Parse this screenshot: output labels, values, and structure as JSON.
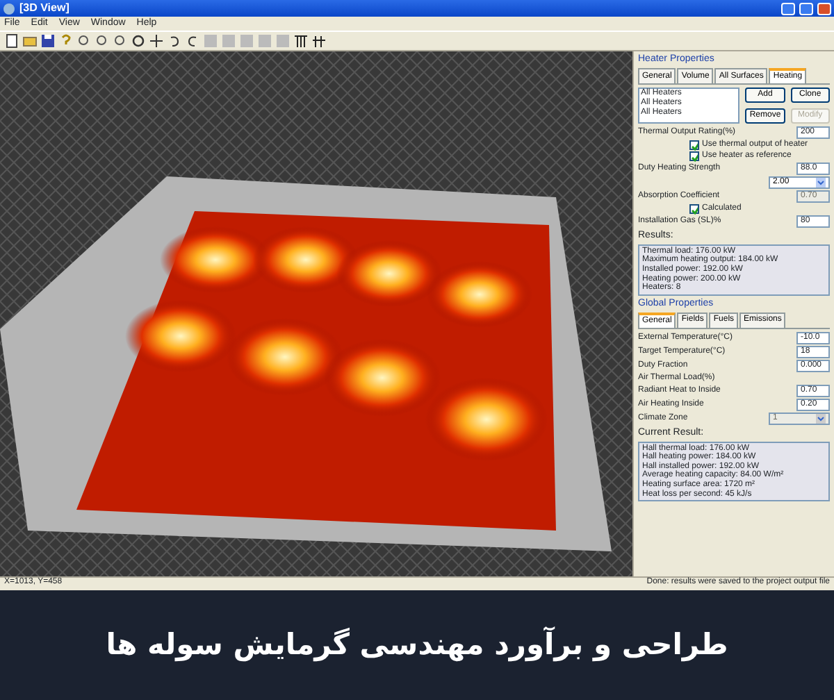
{
  "window": {
    "title": "[3D View]",
    "menus": [
      "File",
      "Edit",
      "View",
      "Window",
      "Help"
    ]
  },
  "heater_properties": {
    "title": "Heater Properties",
    "tabs": [
      {
        "label": "General",
        "selected": false
      },
      {
        "label": "Volume",
        "selected": false
      },
      {
        "label": "All Surfaces",
        "selected": false
      },
      {
        "label": "Heating",
        "selected": true
      }
    ],
    "heaters": [
      {
        "label": "All Heaters",
        "selected": false
      },
      {
        "label": "All Heaters",
        "selected": false
      },
      {
        "label": "All Heaters",
        "selected": false
      }
    ],
    "buttons": [
      {
        "label": "Add",
        "disabled": false
      },
      {
        "label": "Clone",
        "disabled": false
      },
      {
        "label": "Remove",
        "disabled": false
      },
      {
        "label": "Modify",
        "disabled": true
      }
    ],
    "fields": [
      {
        "kind": "input",
        "label": "Thermal Output Rating(%)",
        "value": "200",
        "disabled": false
      },
      {
        "kind": "check",
        "label": "Use thermal output of heater",
        "checked": true
      },
      {
        "kind": "check",
        "label": "Use heater as reference",
        "checked": true
      },
      {
        "kind": "input",
        "label": "Duty Heating Strength",
        "value": "88.0",
        "disabled": false
      },
      {
        "kind": "select",
        "value": "2.00",
        "disabled": false
      },
      {
        "kind": "input",
        "label": "Absorption Coefficient",
        "value": "0.70",
        "disabled": true
      },
      {
        "kind": "check",
        "label": "Calculated",
        "checked": true
      },
      {
        "kind": "input",
        "label": "Installation Gas (SL)%",
        "value": "80",
        "disabled": false
      }
    ]
  },
  "results": {
    "title": "Results:",
    "lines": [
      "Thermal load: 176.00 kW",
      "Maximum heating output: 184.00 kW",
      "Installed power: 192.00 kW",
      "Heating power: 200.00 kW",
      "Heaters: 8"
    ]
  },
  "global_properties": {
    "title": "Global Properties",
    "tabs": [
      {
        "label": "General",
        "selected": true
      },
      {
        "label": "Fields",
        "selected": false
      },
      {
        "label": "Fuels",
        "selected": false
      },
      {
        "label": "Emissions",
        "selected": false
      }
    ],
    "fields": [
      {
        "kind": "input",
        "label": "External Temperature(°C)",
        "value": "-10.0",
        "disabled": false
      },
      {
        "kind": "input",
        "label": "Target Temperature(°C)",
        "value": "18",
        "disabled": false
      },
      {
        "kind": "input",
        "label": "Duty Fraction",
        "value": "0.000",
        "disabled": false
      },
      {
        "kind": "note",
        "label": "Air Thermal Load(%)"
      },
      {
        "kind": "input",
        "label": "Radiant Heat to Inside",
        "value": "0.70",
        "disabled": false
      },
      {
        "kind": "input",
        "label": "Air Heating Inside",
        "value": "0.20",
        "disabled": false
      },
      {
        "kind": "select",
        "label": "Climate Zone",
        "value": "1",
        "disabled": true
      }
    ]
  },
  "current_result": {
    "title": "Current Result:",
    "lines": [
      "Hall thermal load: 176.00 kW",
      "Hall heating power: 184.00 kW",
      "Hall installed power: 192.00 kW",
      "Average heating capacity: 84.00 W/m²",
      "Heating surface area: 1720 m²",
      "Heat loss per second: 45 kJ/s"
    ]
  },
  "status_bar": {
    "position": "X=1013, Y=458",
    "message": "Done: results were saved to the project output file"
  },
  "caption": "طراحی و برآورد مهندسی گرمایش سوله ها"
}
